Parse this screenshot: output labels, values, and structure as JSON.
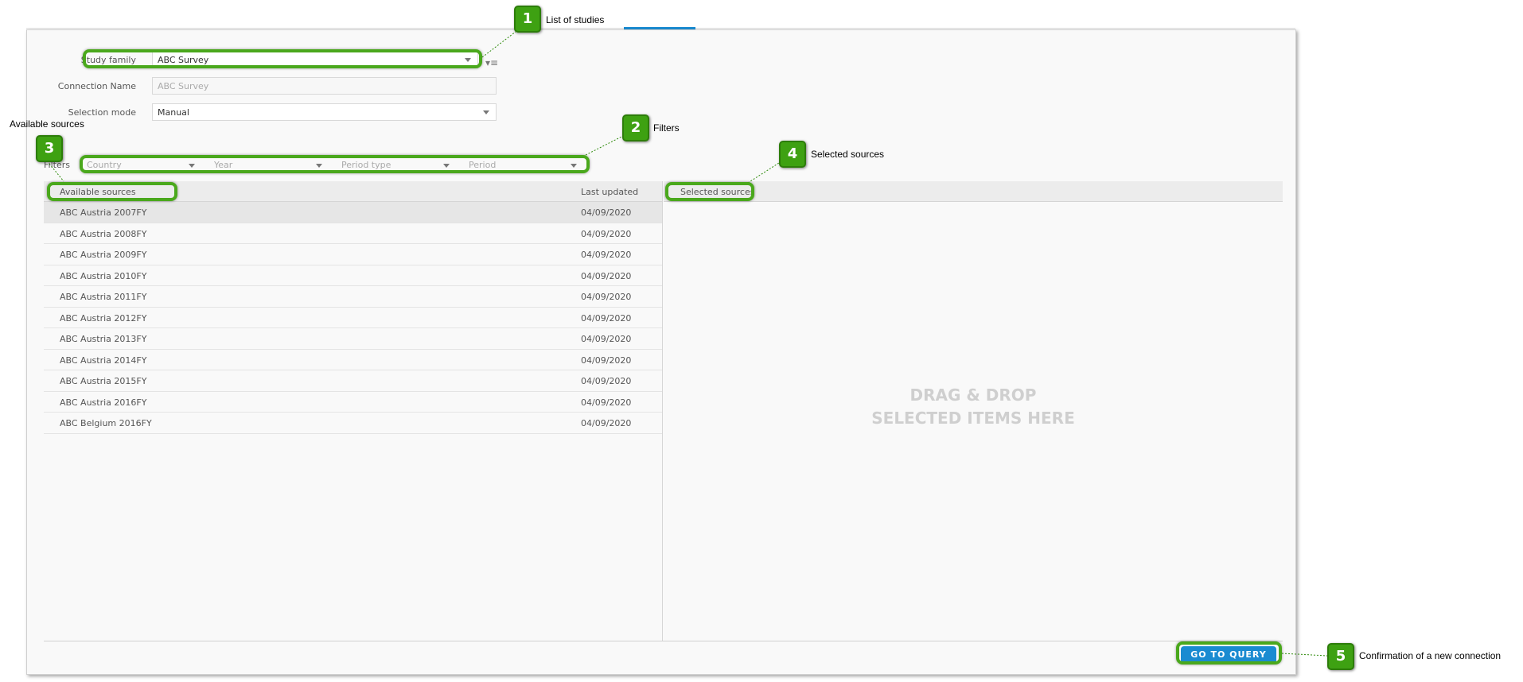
{
  "form": {
    "study_family_label": "Study family",
    "study_family_value": "ABC Survey",
    "connection_name_label": "Connection Name",
    "connection_name_placeholder": "ABC Survey",
    "selection_mode_label": "Selection mode",
    "selection_mode_value": "Manual"
  },
  "filters": {
    "label": "Filters",
    "items": [
      "Country",
      "Year",
      "Period type",
      "Period"
    ]
  },
  "available": {
    "header_name": "Available sources",
    "header_date": "Last updated",
    "rows": [
      {
        "name": "ABC Austria 2007FY",
        "date": "04/09/2020"
      },
      {
        "name": "ABC Austria 2008FY",
        "date": "04/09/2020"
      },
      {
        "name": "ABC Austria 2009FY",
        "date": "04/09/2020"
      },
      {
        "name": "ABC Austria 2010FY",
        "date": "04/09/2020"
      },
      {
        "name": "ABC Austria 2011FY",
        "date": "04/09/2020"
      },
      {
        "name": "ABC Austria 2012FY",
        "date": "04/09/2020"
      },
      {
        "name": "ABC Austria 2013FY",
        "date": "04/09/2020"
      },
      {
        "name": "ABC Austria 2014FY",
        "date": "04/09/2020"
      },
      {
        "name": "ABC Austria 2015FY",
        "date": "04/09/2020"
      },
      {
        "name": "ABC Austria 2016FY",
        "date": "04/09/2020"
      },
      {
        "name": "ABC Belgium 2016FY",
        "date": "04/09/2020"
      }
    ]
  },
  "selected": {
    "header": "Selected sources",
    "drop_line1": "DRAG & DROP",
    "drop_line2": "SELECTED ITEMS HERE"
  },
  "footer": {
    "go_label": "GO TO QUERY"
  },
  "callouts": [
    {
      "num": "1",
      "text": "List of studies"
    },
    {
      "num": "2",
      "text": "Filters"
    },
    {
      "num": "3",
      "text": "Available sources"
    },
    {
      "num": "4",
      "text": "Selected sources"
    },
    {
      "num": "5",
      "text": "Confirmation of a new connection"
    }
  ],
  "colors": {
    "accent": "#1a8bd1",
    "highlight": "#4aa81c",
    "badge": "#3ea112"
  }
}
